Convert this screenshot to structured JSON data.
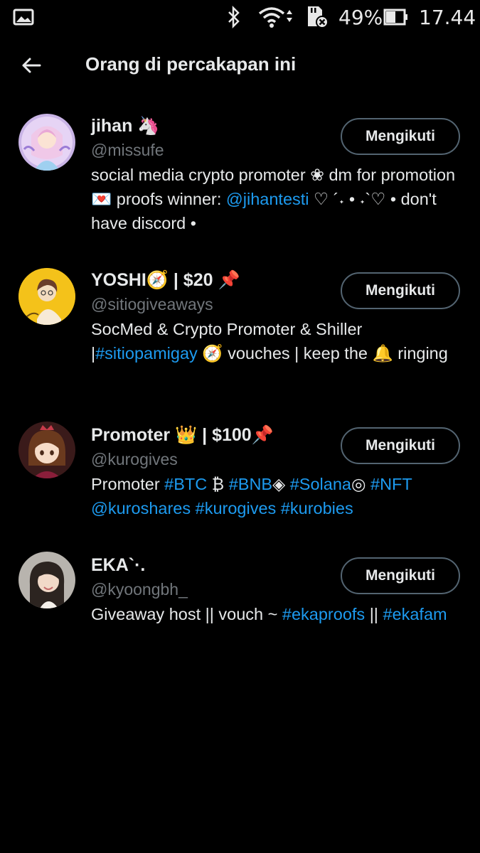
{
  "status_bar": {
    "battery": "49%",
    "time": "17.44",
    "icons": [
      "gallery-icon",
      "bluetooth-icon",
      "wifi-icon",
      "sd-card-icon",
      "battery-icon"
    ]
  },
  "header": {
    "title": "Orang di percakapan ini",
    "back_icon": "arrow-left-icon"
  },
  "users": [
    {
      "name": "jihan 🦄",
      "handle": "@missufe",
      "button": "Mengikuti",
      "bio": [
        {
          "t": "social media crypto promoter ❀ dm for promotion 💌 proofs winner: ",
          "link": false
        },
        {
          "t": "@jihantesti",
          "link": true
        },
        {
          "t": " ♡ ´˖ • ˖`♡ • don't have discord •",
          "link": false
        }
      ]
    },
    {
      "name": "YOSHI🧭 | $20 📌",
      "handle": "@sitiogiveaways",
      "button": "Mengikuti",
      "bio": [
        {
          "t": "SocMed & Crypto Promoter & Shiller |",
          "link": false
        },
        {
          "t": "#sitiopamigay",
          "link": true
        },
        {
          "t": " 🧭 vouches | keep the 🔔 ringing",
          "link": false
        }
      ]
    },
    {
      "name": "Promoter 👑 | $100📌",
      "handle": "@kurogives",
      "button": "Mengikuti",
      "bio": [
        {
          "t": "Promoter ",
          "link": false
        },
        {
          "t": "#BTC",
          "link": true
        },
        {
          "t": " ₿  ",
          "link": false
        },
        {
          "t": "#BNB",
          "link": true
        },
        {
          "t": "◈ ",
          "link": false
        },
        {
          "t": "#Solana",
          "link": true
        },
        {
          "t": "◎ ",
          "link": false
        },
        {
          "t": "#NFT @kuroshares #kurogives #kurobies",
          "link": true
        }
      ]
    },
    {
      "name": "EKA`·.",
      "handle": "@kyoongbh_",
      "button": "Mengikuti",
      "bio": [
        {
          "t": "Giveaway host || vouch ~ ",
          "link": false
        },
        {
          "t": "#ekaproofs",
          "link": true
        },
        {
          "t": " || ",
          "link": false
        },
        {
          "t": "#ekafam",
          "link": true
        }
      ]
    }
  ]
}
